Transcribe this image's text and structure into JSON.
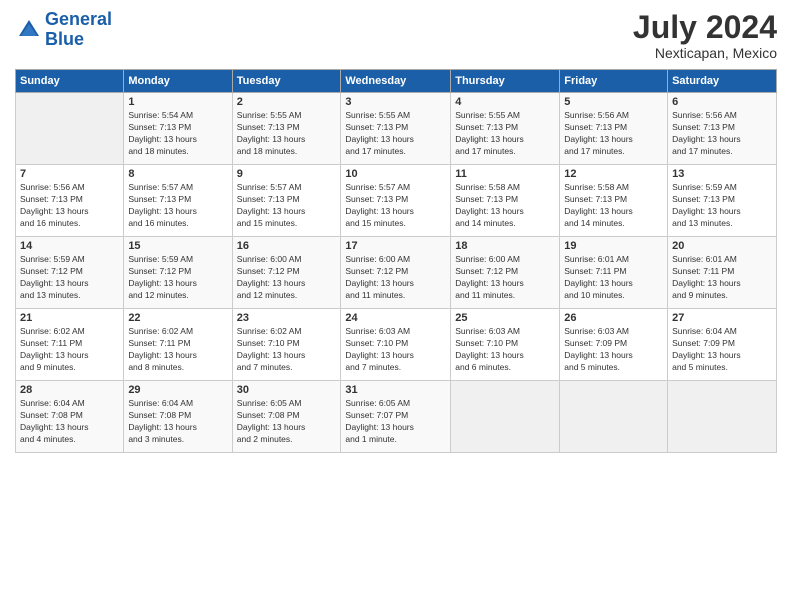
{
  "header": {
    "logo_line1": "General",
    "logo_line2": "Blue",
    "title": "July 2024",
    "location": "Nexticapan, Mexico"
  },
  "calendar": {
    "days_of_week": [
      "Sunday",
      "Monday",
      "Tuesday",
      "Wednesday",
      "Thursday",
      "Friday",
      "Saturday"
    ],
    "weeks": [
      [
        {
          "date": "",
          "info": ""
        },
        {
          "date": "1",
          "info": "Sunrise: 5:54 AM\nSunset: 7:13 PM\nDaylight: 13 hours\nand 18 minutes."
        },
        {
          "date": "2",
          "info": "Sunrise: 5:55 AM\nSunset: 7:13 PM\nDaylight: 13 hours\nand 18 minutes."
        },
        {
          "date": "3",
          "info": "Sunrise: 5:55 AM\nSunset: 7:13 PM\nDaylight: 13 hours\nand 17 minutes."
        },
        {
          "date": "4",
          "info": "Sunrise: 5:55 AM\nSunset: 7:13 PM\nDaylight: 13 hours\nand 17 minutes."
        },
        {
          "date": "5",
          "info": "Sunrise: 5:56 AM\nSunset: 7:13 PM\nDaylight: 13 hours\nand 17 minutes."
        },
        {
          "date": "6",
          "info": "Sunrise: 5:56 AM\nSunset: 7:13 PM\nDaylight: 13 hours\nand 17 minutes."
        }
      ],
      [
        {
          "date": "7",
          "info": "Sunrise: 5:56 AM\nSunset: 7:13 PM\nDaylight: 13 hours\nand 16 minutes."
        },
        {
          "date": "8",
          "info": "Sunrise: 5:57 AM\nSunset: 7:13 PM\nDaylight: 13 hours\nand 16 minutes."
        },
        {
          "date": "9",
          "info": "Sunrise: 5:57 AM\nSunset: 7:13 PM\nDaylight: 13 hours\nand 15 minutes."
        },
        {
          "date": "10",
          "info": "Sunrise: 5:57 AM\nSunset: 7:13 PM\nDaylight: 13 hours\nand 15 minutes."
        },
        {
          "date": "11",
          "info": "Sunrise: 5:58 AM\nSunset: 7:13 PM\nDaylight: 13 hours\nand 14 minutes."
        },
        {
          "date": "12",
          "info": "Sunrise: 5:58 AM\nSunset: 7:13 PM\nDaylight: 13 hours\nand 14 minutes."
        },
        {
          "date": "13",
          "info": "Sunrise: 5:59 AM\nSunset: 7:13 PM\nDaylight: 13 hours\nand 13 minutes."
        }
      ],
      [
        {
          "date": "14",
          "info": "Sunrise: 5:59 AM\nSunset: 7:12 PM\nDaylight: 13 hours\nand 13 minutes."
        },
        {
          "date": "15",
          "info": "Sunrise: 5:59 AM\nSunset: 7:12 PM\nDaylight: 13 hours\nand 12 minutes."
        },
        {
          "date": "16",
          "info": "Sunrise: 6:00 AM\nSunset: 7:12 PM\nDaylight: 13 hours\nand 12 minutes."
        },
        {
          "date": "17",
          "info": "Sunrise: 6:00 AM\nSunset: 7:12 PM\nDaylight: 13 hours\nand 11 minutes."
        },
        {
          "date": "18",
          "info": "Sunrise: 6:00 AM\nSunset: 7:12 PM\nDaylight: 13 hours\nand 11 minutes."
        },
        {
          "date": "19",
          "info": "Sunrise: 6:01 AM\nSunset: 7:11 PM\nDaylight: 13 hours\nand 10 minutes."
        },
        {
          "date": "20",
          "info": "Sunrise: 6:01 AM\nSunset: 7:11 PM\nDaylight: 13 hours\nand 9 minutes."
        }
      ],
      [
        {
          "date": "21",
          "info": "Sunrise: 6:02 AM\nSunset: 7:11 PM\nDaylight: 13 hours\nand 9 minutes."
        },
        {
          "date": "22",
          "info": "Sunrise: 6:02 AM\nSunset: 7:11 PM\nDaylight: 13 hours\nand 8 minutes."
        },
        {
          "date": "23",
          "info": "Sunrise: 6:02 AM\nSunset: 7:10 PM\nDaylight: 13 hours\nand 7 minutes."
        },
        {
          "date": "24",
          "info": "Sunrise: 6:03 AM\nSunset: 7:10 PM\nDaylight: 13 hours\nand 7 minutes."
        },
        {
          "date": "25",
          "info": "Sunrise: 6:03 AM\nSunset: 7:10 PM\nDaylight: 13 hours\nand 6 minutes."
        },
        {
          "date": "26",
          "info": "Sunrise: 6:03 AM\nSunset: 7:09 PM\nDaylight: 13 hours\nand 5 minutes."
        },
        {
          "date": "27",
          "info": "Sunrise: 6:04 AM\nSunset: 7:09 PM\nDaylight: 13 hours\nand 5 minutes."
        }
      ],
      [
        {
          "date": "28",
          "info": "Sunrise: 6:04 AM\nSunset: 7:08 PM\nDaylight: 13 hours\nand 4 minutes."
        },
        {
          "date": "29",
          "info": "Sunrise: 6:04 AM\nSunset: 7:08 PM\nDaylight: 13 hours\nand 3 minutes."
        },
        {
          "date": "30",
          "info": "Sunrise: 6:05 AM\nSunset: 7:08 PM\nDaylight: 13 hours\nand 2 minutes."
        },
        {
          "date": "31",
          "info": "Sunrise: 6:05 AM\nSunset: 7:07 PM\nDaylight: 13 hours\nand 1 minute."
        },
        {
          "date": "",
          "info": ""
        },
        {
          "date": "",
          "info": ""
        },
        {
          "date": "",
          "info": ""
        }
      ]
    ]
  }
}
